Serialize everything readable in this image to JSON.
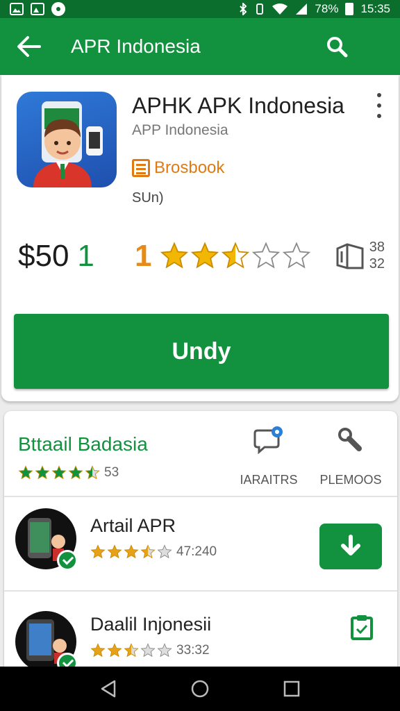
{
  "status_bar": {
    "battery": "78%",
    "time": "15:35"
  },
  "app_bar": {
    "title": "APR Indonesia"
  },
  "app": {
    "name": "APHK APK Indonesia",
    "developer": "APP Indonesia",
    "category": "Brosbook",
    "subinfo": "SUn)",
    "price_main": "$50",
    "price_suffix": "1",
    "rating_value": "1",
    "rating_stars": 2.5,
    "size_top": "38",
    "size_bottom": "32",
    "install_label": "Undy"
  },
  "section": {
    "title": "Bttaail Badasia",
    "rating_stars": 4.5,
    "rating_count": "53",
    "action1_label": "IARAITRS",
    "action2_label": "PLEMOOS"
  },
  "list": [
    {
      "title": "Artail APR",
      "rating_stars": 3.5,
      "count": "47:240"
    },
    {
      "title": "Daalil Injonesii",
      "rating_stars": 2.5,
      "count": "33:32"
    }
  ],
  "colors": {
    "primary": "#12923f",
    "status": "#0b6e2d",
    "accent": "#e07a12",
    "star": "#f2b705"
  }
}
